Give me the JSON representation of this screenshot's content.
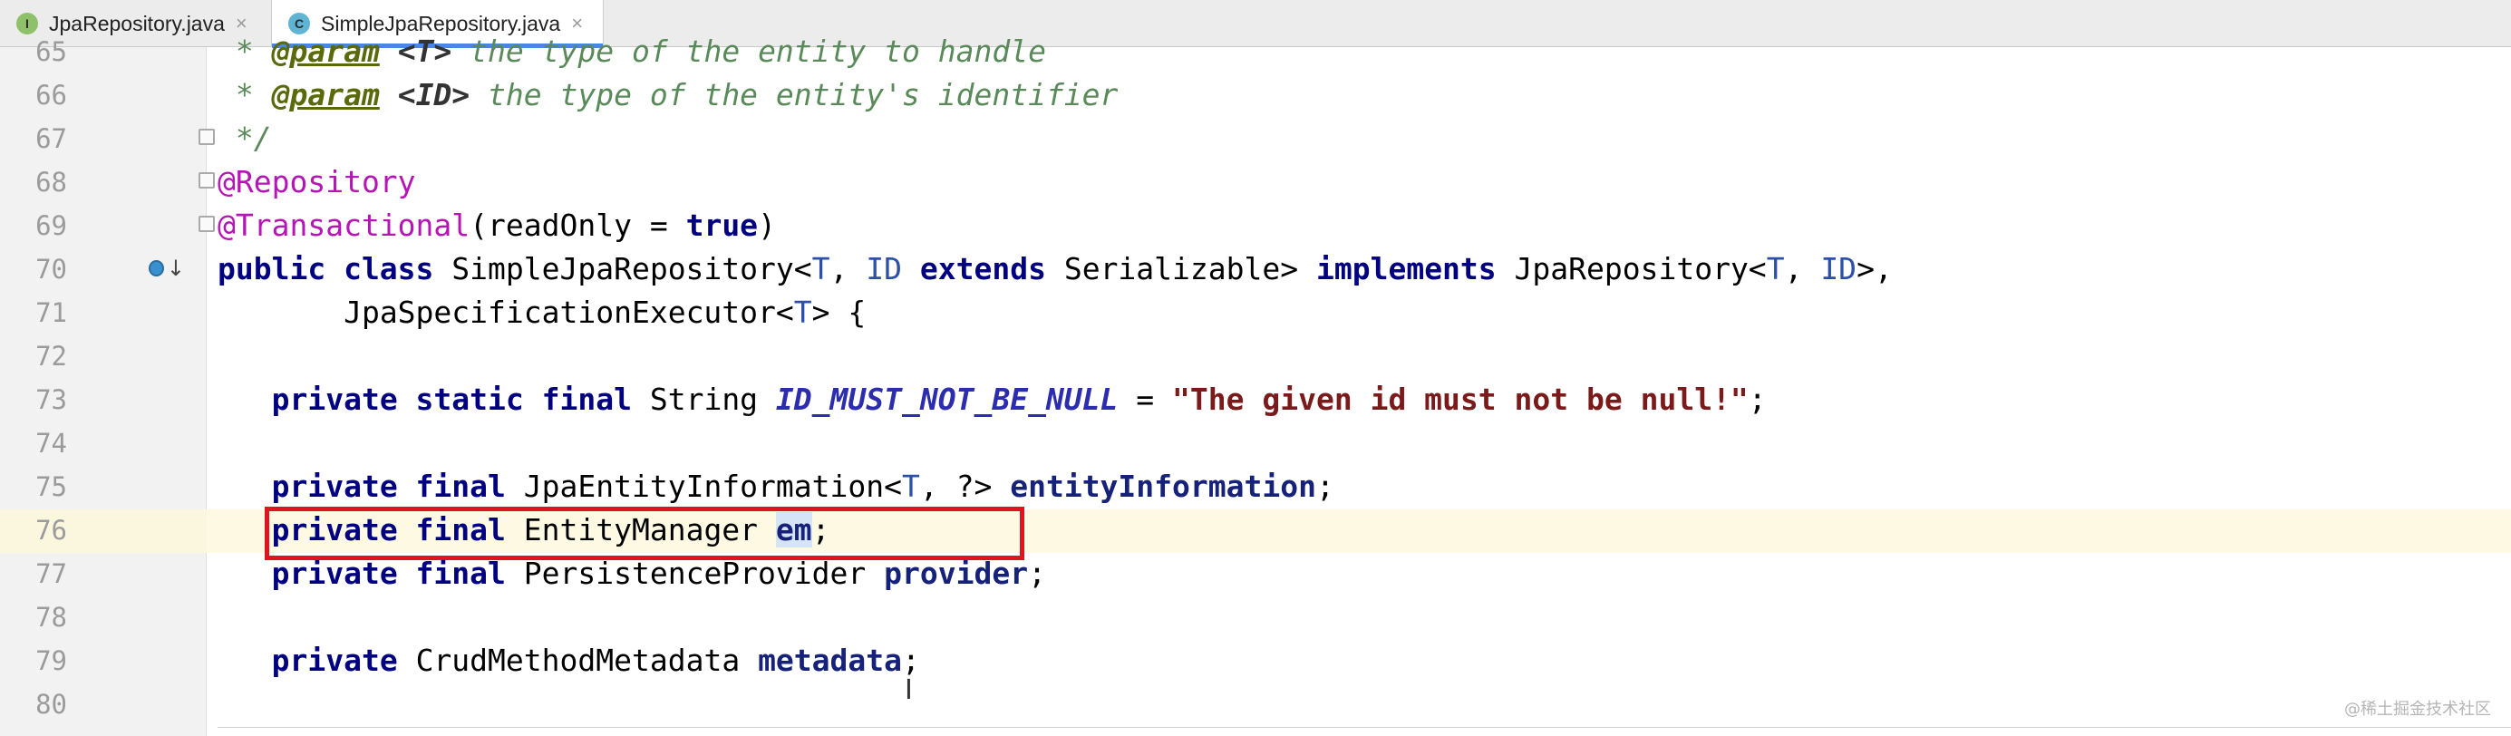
{
  "tabs": [
    {
      "icon_letter": "I",
      "label": "JpaRepository.java",
      "close": "×"
    },
    {
      "icon_letter": "C",
      "label": "SimpleJpaRepository.java",
      "close": "×"
    }
  ],
  "line_numbers": [
    "65",
    "66",
    "67",
    "68",
    "69",
    "70",
    "71",
    "72",
    "73",
    "74",
    "75",
    "76",
    "77",
    "78",
    "79",
    "80"
  ],
  "code": {
    "l65": {
      "star": " * ",
      "tag": "@param",
      "ref": " <T>",
      "text": " the type of the entity to handle"
    },
    "l66": {
      "star": " * ",
      "tag": "@param",
      "ref": " <ID>",
      "text": " the type of the entity's identifier"
    },
    "l67": " */",
    "l68": "@Repository",
    "l69": {
      "ann": "@Transactional",
      "open": "(readOnly = ",
      "kw": "true",
      "close": ")"
    },
    "l70": {
      "kw1": "public class ",
      "name": "SimpleJpaRepository<",
      "t": "T",
      "c1": ", ",
      "id": "ID",
      "kw2": " extends ",
      "ser": "Serializable> ",
      "kw3": "implements ",
      "jr": "JpaRepository<",
      "t2": "T",
      "c2": ", ",
      "id2": "ID",
      "end": ">,"
    },
    "l71": {
      "indent": "       ",
      "exec": "JpaSpecificationExecutor<",
      "t": "T",
      "end": "> {"
    },
    "l73": {
      "indent": "   ",
      "kw": "private static final ",
      "type": "String ",
      "const": "ID_MUST_NOT_BE_NULL",
      "eq": " = ",
      "str": "\"The given id must not be null!\"",
      "semi": ";"
    },
    "l75": {
      "indent": "   ",
      "kw": "private final ",
      "type": "JpaEntityInformation<",
      "t": "T",
      "rest": ", ?> ",
      "field": "entityInformation",
      "semi": ";"
    },
    "l76": {
      "indent": "   ",
      "kw": "private final ",
      "type": "EntityManager ",
      "field": "em",
      "semi": ";"
    },
    "l77": {
      "indent": "   ",
      "kw": "private final ",
      "type": "PersistenceProvider ",
      "field": "provider",
      "semi": ";"
    },
    "l79": {
      "indent": "   ",
      "kw": "private ",
      "type": "CrudMethodMetadata ",
      "field": "metadata",
      "semi": ";"
    }
  },
  "watermark": "@稀土掘金技术社区",
  "colors": {
    "keyword": "#1a7a1a",
    "annotation": "#b515b5",
    "string": "#7a1a1a",
    "highlight_box": "#e0141e",
    "current_line": "#fdf9e3"
  }
}
